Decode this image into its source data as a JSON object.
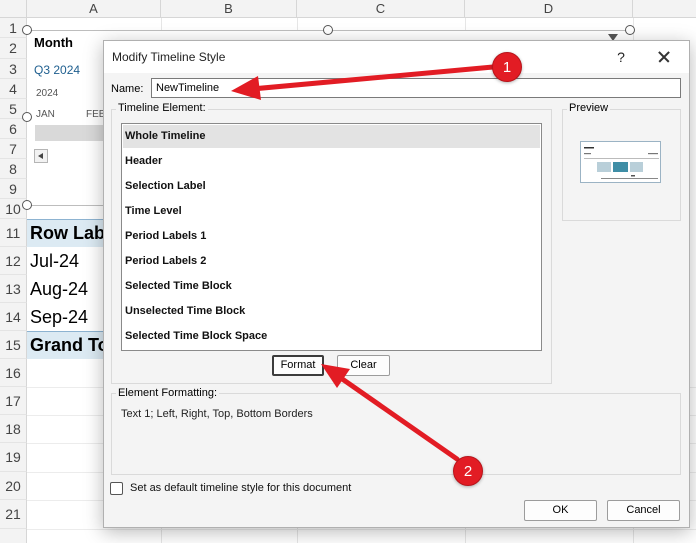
{
  "spreadsheet": {
    "columns": [
      "A",
      "B",
      "C",
      "D"
    ],
    "rows": [
      "1",
      "2",
      "3",
      "4",
      "5",
      "6",
      "7",
      "8",
      "9",
      "10",
      "11",
      "12",
      "13",
      "14",
      "15",
      "16",
      "17",
      "18",
      "19",
      "20",
      "21"
    ],
    "timeline": {
      "title": "Month",
      "period": "Q3 2024",
      "year": "2024",
      "months": [
        "JAN",
        "FEB"
      ]
    },
    "pivot": {
      "row_labels_header": "Row Labels",
      "rows": [
        "Jul-24",
        "Aug-24",
        "Sep-24"
      ],
      "grand_total": "Grand Total"
    }
  },
  "dialog": {
    "title": "Modify Timeline Style",
    "help_label": "?",
    "name_label": "Name:",
    "name_value": "NewTimeline",
    "timeline_element_label": "Timeline Element:",
    "elements": [
      "Whole Timeline",
      "Header",
      "Selection Label",
      "Time Level",
      "Period Labels 1",
      "Period Labels 2",
      "Selected Time Block",
      "Unselected Time Block",
      "Selected Time Block Space"
    ],
    "selected_element": "Whole Timeline",
    "format_button": "Format",
    "clear_button": "Clear",
    "preview_label": "Preview",
    "element_formatting_label": "Element Formatting:",
    "element_formatting_text": "Text 1; Left, Right, Top, Bottom Borders",
    "default_checkbox_label": "Set as default timeline style for this document",
    "default_checkbox_checked": false,
    "ok_button": "OK",
    "cancel_button": "Cancel"
  },
  "annotations": {
    "color": "#e21c24",
    "badges": [
      "1",
      "2"
    ]
  }
}
